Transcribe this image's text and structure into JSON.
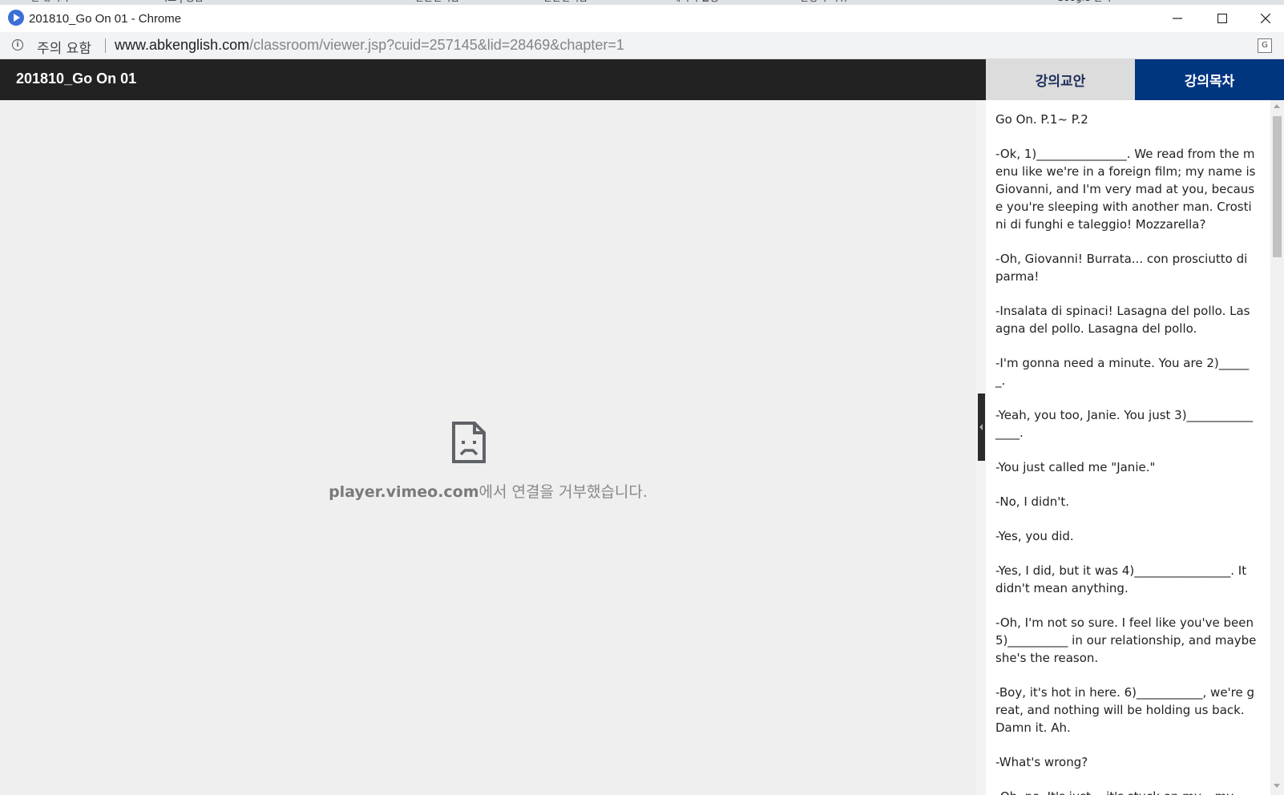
{
  "browser": {
    "window_title": "201810_Go On 01 - Chrome",
    "security_label": "주의 요함",
    "url_host": "www.abkenglish.com",
    "url_path": "/classroom/viewer.jsp?cuid=257145&lid=28469&chapter=1",
    "background_tabs": [
      "전체/리카",
      "서초 | 종합",
      "NAVER",
      "받은편지함",
      "받은편지함",
      "데이터 활용",
      "한영기 어휘",
      "Daum",
      "Google 번역"
    ]
  },
  "header": {
    "lecture_title": "201810_Go On 01"
  },
  "tabs": {
    "materials": "강의교안",
    "contents": "강의목차"
  },
  "video": {
    "error_host": "player.vimeo.com",
    "error_message": "에서 연결을 거부했습니다."
  },
  "script": {
    "paragraphs": [
      "Go On. P.1~ P.2",
      "-Ok, 1)_______________. We read from the menu like we're in a foreign film; my name is Giovanni, and I'm very mad at you, because you're sleeping with another man. Crostini di funghi e taleggio! Mozzarella?",
      "-Oh, Giovanni! Burrata... con prosciutto di parma!",
      "-Insalata di spinaci! Lasagna del pollo. Lasagna del pollo. Lasagna del pollo.",
      "-I'm gonna need a minute. You are 2)______.",
      "-Yeah, you too, Janie. You just 3)_______________.",
      "-You just called me \"Janie.\"",
      "-No, I didn't.",
      "-Yes, you did.",
      "-Yes, I did, but it was 4)________________. It didn't mean anything.",
      "-Oh, I'm not so sure. I feel like you've been 5)__________ in our relationship, and maybe she's the reason.",
      "-Boy, it's hot in here. 6)___________, we're great, and nothing will be holding us back. Damn it. Ah.",
      "-What's wrong?",
      "-Oh, no. It's just... it's stuck on my... my..."
    ]
  },
  "colors": {
    "header_bg": "#222222",
    "tab_active_bg": "#003580",
    "tab_inactive_bg": "#dcdcdc",
    "video_bg": "#efefef"
  },
  "icons": {
    "app": "chrome-play-icon",
    "security": "info-icon",
    "translate": "translate-icon",
    "error": "sad-document-icon"
  }
}
